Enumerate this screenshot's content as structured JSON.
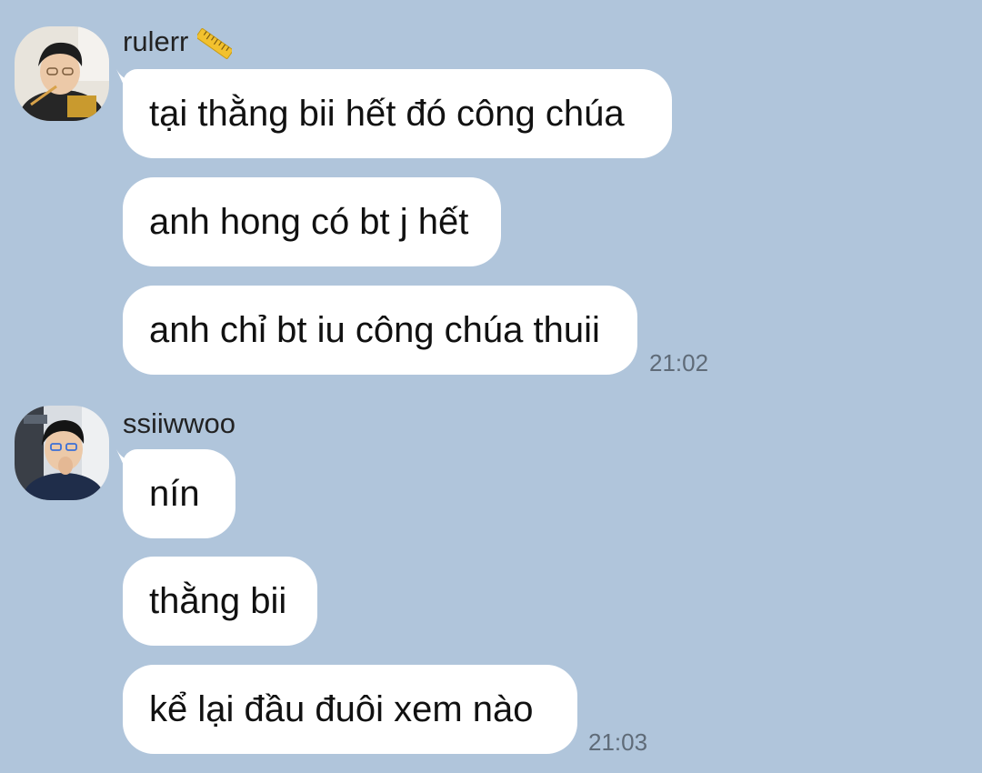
{
  "chat": {
    "groups": [
      {
        "sender": "rulerr",
        "sender_badge_icon": "ruler-icon",
        "avatar_icon": "avatar-rulerr",
        "messages": [
          "tại thằng bii hết đó công chúa",
          "anh hong có bt j hết",
          "anh chỉ bt iu công chúa thuii"
        ],
        "time": "21:02"
      },
      {
        "sender": "ssiiwwoo",
        "avatar_icon": "avatar-ssiiwwoo",
        "messages": [
          "nín",
          "thằng bii",
          "kể lại đầu đuôi xem nào"
        ],
        "time": "21:03"
      }
    ]
  },
  "colors": {
    "background": "#b0c5db",
    "bubble": "#ffffff",
    "text": "#111111",
    "timestamp": "#5f6b78"
  }
}
